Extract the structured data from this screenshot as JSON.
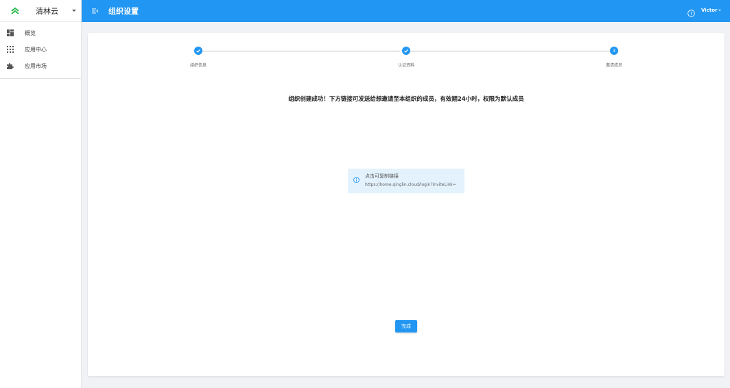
{
  "app": {
    "org_name": "清林云",
    "brand_color": "#2196f3",
    "logo_color": "#2db84d"
  },
  "sidebar": {
    "items": [
      {
        "label": "概览",
        "icon": "dashboard-icon"
      },
      {
        "label": "应用中心",
        "icon": "apps-grid-icon"
      },
      {
        "label": "应用市场",
        "icon": "puzzle-icon"
      }
    ]
  },
  "header": {
    "title": "组织设置",
    "user": "Victor"
  },
  "steps": [
    {
      "label": "组织信息",
      "state": "done"
    },
    {
      "label": "认证资料",
      "state": "done"
    },
    {
      "label": "邀请成员",
      "state": "current",
      "number": "3"
    }
  ],
  "main": {
    "message": "组织创建成功！下方链接可发送给想邀请至本组织的成员，有效期24小时，权限为默认成员",
    "alert_title": "点击可复制链接",
    "invite_link": "https://home.qinglin.cloud/login?inviteLink=",
    "done_label": "完成"
  }
}
